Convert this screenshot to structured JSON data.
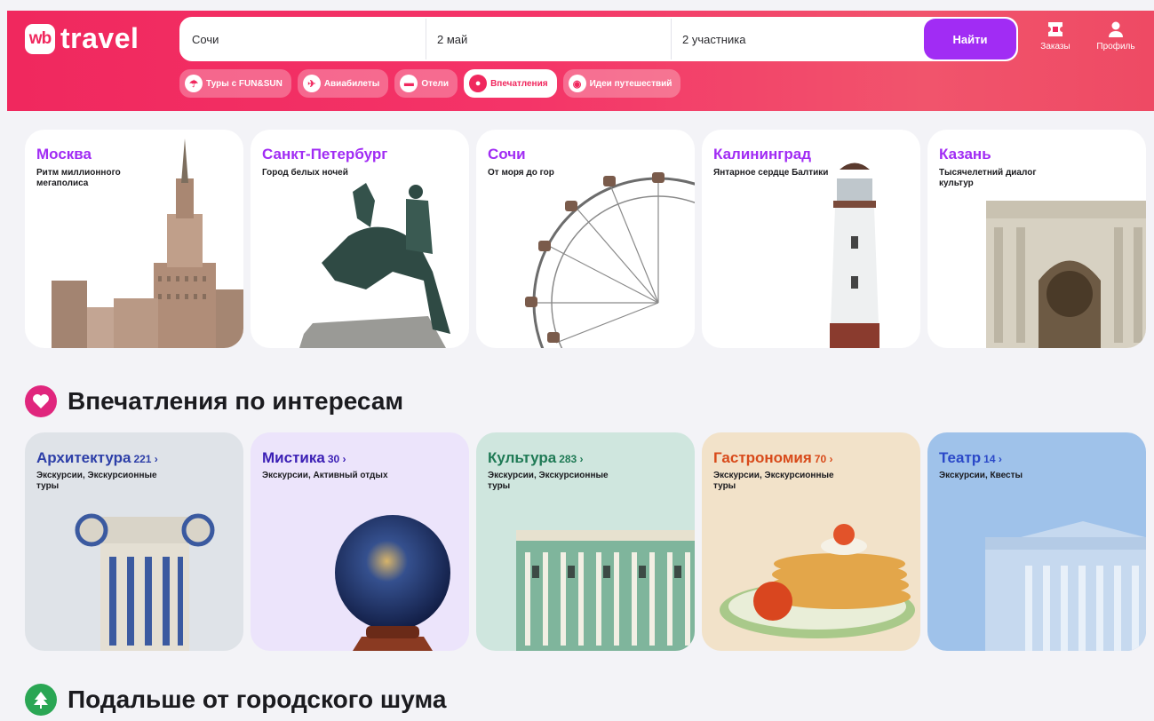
{
  "header": {
    "logo_badge": "wb",
    "logo_text": "travel",
    "search": {
      "destination": "Сочи",
      "date": "2 май",
      "guests": "2 участника",
      "button": "Найти"
    },
    "orders_label": "Заказы",
    "profile_label": "Профиль",
    "chips": [
      {
        "label": "Туры с FUN&SUN",
        "icon": "beach-umbrella-icon"
      },
      {
        "label": "Авиабилеты",
        "icon": "plane-icon"
      },
      {
        "label": "Отели",
        "icon": "bed-icon"
      },
      {
        "label": "Впечатления",
        "icon": "balloon-icon",
        "active": true
      },
      {
        "label": "Идеи путешествий",
        "icon": "globe-icon"
      }
    ]
  },
  "cities": [
    {
      "name": "Москва",
      "subtitle": "Ритм миллионного мегаполиса"
    },
    {
      "name": "Санкт-Петербург",
      "subtitle": "Город белых ночей"
    },
    {
      "name": "Сочи",
      "subtitle": "От моря до гор"
    },
    {
      "name": "Калининград",
      "subtitle": "Янтарное сердце Балтики"
    },
    {
      "name": "Казань",
      "subtitle": "Тысячелетний диалог культур"
    }
  ],
  "section_interests": {
    "title": "Впечатления по интересам",
    "icon": "heart-icon"
  },
  "interests": [
    {
      "name": "Архитектура",
      "count": "221 ›",
      "subtitle": "Экскурсии, Экскурсионные туры",
      "color": "#2d3fa8",
      "bg": "#dfe3e8"
    },
    {
      "name": "Мистика",
      "count": "30 ›",
      "subtitle": "Экскурсии, Активный отдых",
      "color": "#3b1fb5",
      "bg": "#ece4fb"
    },
    {
      "name": "Культура",
      "count": "283 ›",
      "subtitle": "Экскурсии, Экскурсионные туры",
      "color": "#1f7a55",
      "bg": "#cfe6de"
    },
    {
      "name": "Гастрономия",
      "count": "70 ›",
      "subtitle": "Экскурсии, Экскурсионные туры",
      "color": "#d84a1a",
      "bg": "#f2e2c9"
    },
    {
      "name": "Театр",
      "count": "14 ›",
      "subtitle": "Экскурсии, Квесты",
      "color": "#2a48c8",
      "bg": "#9fc2ea"
    }
  ],
  "section_nature": {
    "title": "Подальше от городского шума",
    "icon": "tree-icon"
  }
}
